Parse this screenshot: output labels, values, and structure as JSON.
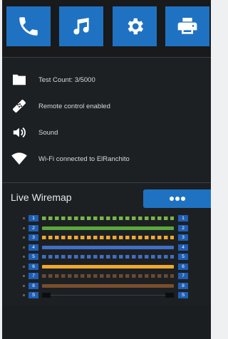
{
  "toolbar": {
    "buttons": [
      {
        "name": "phone",
        "icon": "phone-icon"
      },
      {
        "name": "music",
        "icon": "music-note-icon"
      },
      {
        "name": "settings",
        "icon": "gear-icon"
      },
      {
        "name": "print",
        "icon": "printer-icon"
      }
    ]
  },
  "status": {
    "test_count": "Test Count: 3/5000",
    "remote": "Remote control enabled",
    "sound": "Sound",
    "wifi": "Wi-Fi connected to ElRanchito"
  },
  "wiremap": {
    "title": "Live Wiremap",
    "more_icon": "more-dots-icon",
    "pairs": [
      {
        "left": "1",
        "right": "1",
        "color": "#7ab648",
        "style": "striped"
      },
      {
        "left": "2",
        "right": "2",
        "color": "#5aa83a",
        "style": "solid"
      },
      {
        "left": "3",
        "right": "3",
        "color": "#f0a82e",
        "style": "striped"
      },
      {
        "left": "4",
        "right": "4",
        "color": "#3f6fc6",
        "style": "solid"
      },
      {
        "left": "5",
        "right": "5",
        "color": "#3f6fc6",
        "style": "striped"
      },
      {
        "left": "6",
        "right": "6",
        "color": "#f0a82e",
        "style": "solid"
      },
      {
        "left": "7",
        "right": "7",
        "color": "#6a4a32",
        "style": "striped"
      },
      {
        "left": "8",
        "right": "8",
        "color": "#7a4e2c",
        "style": "solid"
      },
      {
        "left": "S",
        "right": "S",
        "color": "#2a2e33",
        "style": "shield"
      }
    ]
  }
}
